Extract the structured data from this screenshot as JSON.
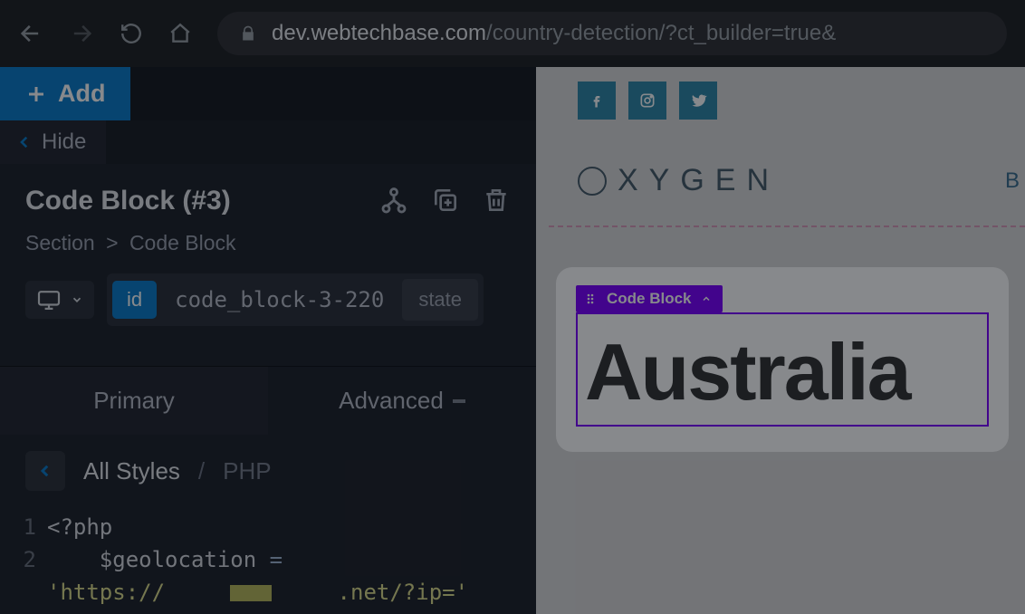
{
  "browser": {
    "url_domain": "dev.webtechbase.com",
    "url_path": "/country-detection/?ct_builder=true&"
  },
  "toolbar": {
    "add_label": "Add",
    "hide_label": "Hide"
  },
  "element": {
    "title": "Code Block (#3)",
    "breadcrumb_root": "Section",
    "breadcrumb_current": "Code Block",
    "id_chip": "id",
    "id_value": "code_block-3-220",
    "state_chip": "state"
  },
  "tabs": {
    "primary": "Primary",
    "advanced": "Advanced"
  },
  "subnav": {
    "all_styles": "All Styles",
    "php": "PHP"
  },
  "code": {
    "lines": [
      {
        "n": "1",
        "t": "<?php"
      },
      {
        "n": "2",
        "t": "    $geolocation ="
      },
      {
        "n": "",
        "t": "'https://            .net/?ip='"
      }
    ]
  },
  "preview": {
    "logo_text": "XYGEN",
    "logo_right": "B",
    "tag_label": "Code Block",
    "output_text": "Australia"
  }
}
